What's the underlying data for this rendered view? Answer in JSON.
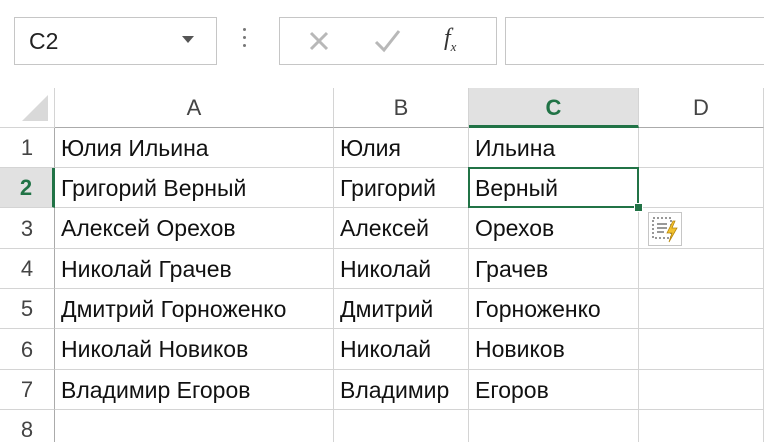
{
  "name_box": {
    "value": "C2"
  },
  "formula_bar": {
    "value": ""
  },
  "columns": [
    "A",
    "B",
    "C",
    "D"
  ],
  "selected_column": "C",
  "selected_row": "2",
  "rows": [
    {
      "num": "1",
      "cells": [
        "Юлия Ильина",
        "Юлия",
        "Ильина",
        ""
      ]
    },
    {
      "num": "2",
      "cells": [
        "Григорий Верный",
        "Григорий",
        "Верный",
        ""
      ]
    },
    {
      "num": "3",
      "cells": [
        "Алексей Орехов",
        "Алексей",
        "Орехов",
        ""
      ]
    },
    {
      "num": "4",
      "cells": [
        "Николай Грачев",
        "Николай",
        "Грачев",
        ""
      ]
    },
    {
      "num": "5",
      "cells": [
        "Дмитрий Горноженко",
        "Дмитрий",
        "Горноженко",
        ""
      ]
    },
    {
      "num": "6",
      "cells": [
        "Николай Новиков",
        "Николай",
        "Новиков",
        ""
      ]
    },
    {
      "num": "7",
      "cells": [
        "Владимир Егоров",
        "Владимир",
        "Егоров",
        ""
      ]
    },
    {
      "num": "8",
      "cells": [
        "",
        "",
        "",
        ""
      ]
    }
  ],
  "icons": {
    "cancel": "x-icon",
    "enter": "checkmark-icon",
    "insert_function": "fx-icon",
    "flash_fill": "flash-fill-icon"
  },
  "colors": {
    "accent": "#217346"
  }
}
